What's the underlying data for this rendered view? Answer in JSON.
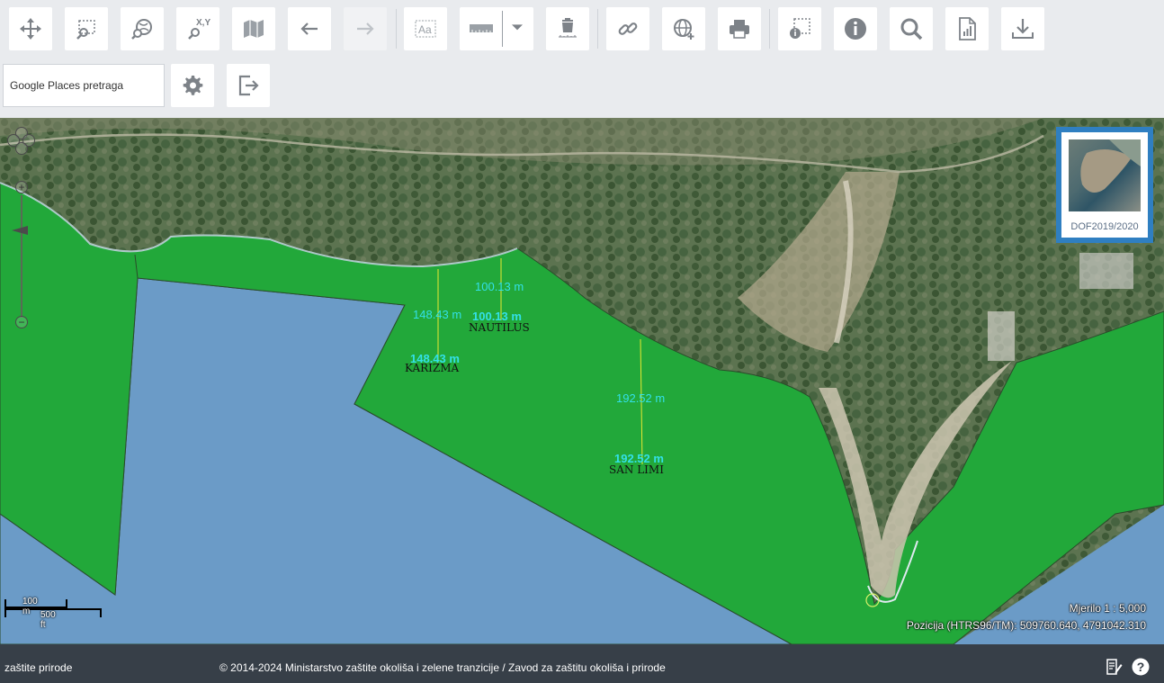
{
  "toolbar": {
    "buttons": [
      {
        "name": "pan-button",
        "icon": "move-icon"
      },
      {
        "name": "zoom-box-button",
        "icon": "zoom-box-icon"
      },
      {
        "name": "zoom-globe-button",
        "icon": "zoom-globe-icon"
      },
      {
        "name": "goto-xy-button",
        "icon": "xy-search-icon"
      },
      {
        "name": "map-layers-button",
        "icon": "map-icon"
      },
      {
        "name": "back-button",
        "icon": "arrow-left-icon"
      },
      {
        "name": "forward-button",
        "icon": "arrow-right-icon"
      },
      {
        "name": "text-label-button",
        "icon": "text-icon"
      },
      {
        "name": "measure-button",
        "icon": "ruler-icon"
      },
      {
        "name": "delete-measure-button",
        "icon": "trash-icon"
      },
      {
        "name": "link-button",
        "icon": "link-icon"
      },
      {
        "name": "add-wms-button",
        "icon": "globe-plus-icon"
      },
      {
        "name": "print-button",
        "icon": "printer-icon"
      },
      {
        "name": "select-info-button",
        "icon": "select-info-icon"
      },
      {
        "name": "info-button",
        "icon": "info-icon"
      },
      {
        "name": "search-button",
        "icon": "search-icon"
      },
      {
        "name": "report-button",
        "icon": "report-icon"
      },
      {
        "name": "download-button",
        "icon": "download-icon"
      }
    ],
    "search_placeholder": "Google Places pretraga",
    "settings_icon": "gear-icon",
    "logout_icon": "exit-icon"
  },
  "map": {
    "labels": {
      "karizma": "KARIZMA",
      "nautilus": "NAUTILUS",
      "san_limi": "SAN LIMI"
    },
    "measurements": {
      "m1": "148.43 m",
      "m2": "100.13 m",
      "m3": "192.52 m"
    },
    "basemap_thumb_caption": "DOF2019/2020",
    "scale": {
      "metric": "100 m",
      "imperial": "500 ft"
    },
    "scale_text": "Mjerilo 1 : 5,000",
    "position_text": "Pozicija (HTRS96/TM):  509760.640, 4791042.310",
    "colors": {
      "protected_area": "#22a83a",
      "sea": "#6b9bc7",
      "measure_line": "#e8e832",
      "measure_text": "#33e0e8"
    }
  },
  "footer": {
    "left_text": "zaštite prirode",
    "copyright": "© 2014-2024 Ministarstvo zaštite okoliša i zelene tranzicije / Zavod za zaštitu okoliša i prirode",
    "notes_icon": "notes-icon",
    "help_icon": "help-icon"
  }
}
